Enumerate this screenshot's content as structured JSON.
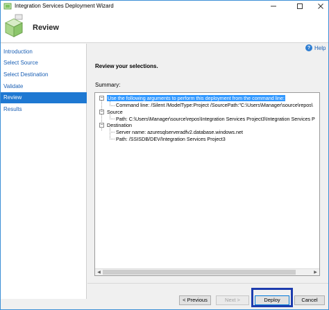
{
  "window": {
    "title": "Integration Services Deployment Wizard"
  },
  "header": {
    "title": "Review"
  },
  "sidebar": {
    "items": [
      {
        "label": "Introduction",
        "active": false
      },
      {
        "label": "Select Source",
        "active": false
      },
      {
        "label": "Select Destination",
        "active": false
      },
      {
        "label": "Validate",
        "active": false
      },
      {
        "label": "Review",
        "active": true
      },
      {
        "label": "Results",
        "active": false
      }
    ]
  },
  "content": {
    "help_label": "Help",
    "heading": "Review your selections.",
    "summary_label": "Summary:",
    "tree": {
      "arguments_node": "Use the following arguments to perform this deployment from the command line:",
      "command_line": "Command line: /Silent /ModelType:Project /SourcePath:\"C:\\Users\\Manager\\source\\repos\\",
      "source_node": "Source",
      "source_path": "Path: C:\\Users\\Manager\\source\\repos\\Integration Services Project3\\Integration Services P",
      "destination_node": "Destination",
      "server_name": "Server name: azuresqlserveradfv2.database.windows.net",
      "destination_path": "Path: /SSISDB/DEV/Integration Services Project3"
    }
  },
  "buttons": {
    "previous": "< Previous",
    "next": "Next >",
    "deploy": "Deploy",
    "cancel": "Cancel"
  },
  "icons": {
    "app": "wizard-app-icon",
    "header": "deployment-package-icon",
    "help": "help-icon",
    "minimize": "minimize-icon",
    "maximize": "maximize-icon",
    "close": "close-icon"
  },
  "colors": {
    "accent": "#1e78d2",
    "highlight_border": "#1d3cae",
    "selection": "#3399ff"
  }
}
